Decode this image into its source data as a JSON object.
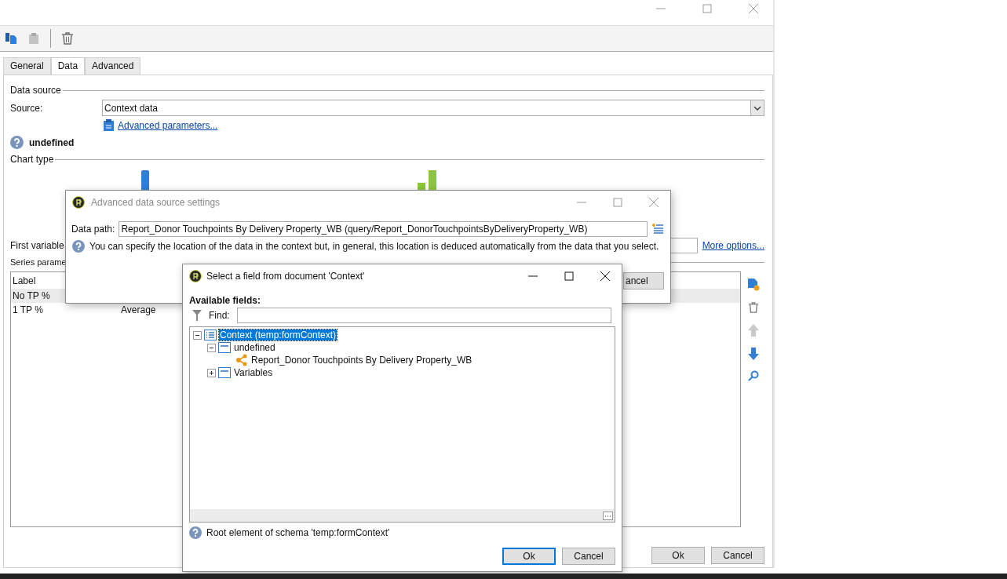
{
  "main_window": {
    "toolbar": [
      {
        "kind": "copy",
        "disabled": false
      },
      {
        "kind": "paste",
        "disabled": true
      },
      {
        "kind": "delete",
        "disabled": false
      }
    ],
    "tabs": [
      {
        "label": "General",
        "selected": false
      },
      {
        "label": "Data",
        "selected": true
      },
      {
        "label": "Advanced",
        "selected": false
      }
    ],
    "data_source": {
      "title": "Data source",
      "source_label": "Source:",
      "source_value": "Context data",
      "advanced_link": "Advanced parameters..."
    },
    "info_label": "undefined",
    "chart_type": {
      "title": "Chart type"
    },
    "first_variable_label": "First variable",
    "more_options_link": "More options...",
    "series": {
      "title": "Series parame",
      "columns": [
        "Label"
      ],
      "rows": [
        {
          "label": "No TP %",
          "selected": true
        },
        {
          "label": "1 TP %",
          "aggregate": "Average",
          "selected": false
        }
      ]
    },
    "buttons": [
      {
        "label": "Ok"
      },
      {
        "label": "Cancel"
      }
    ]
  },
  "advanced_dialog": {
    "title": "Advanced data source settings",
    "active": false,
    "data_path_label": "Data path:",
    "data_path_value": "Report_Donor Touchpoints By Delivery Property_WB (query/Report_DonorTouchpointsByDeliveryProperty_WB)",
    "hint": "You can specify the location of the data in the context but, in general, this location is deduced automatically from the data that you select.",
    "cancel": "ancel"
  },
  "field_dialog": {
    "title": "Select a field from document 'Context'",
    "active": true,
    "available_label": "Available fields:",
    "find_label": "Find:",
    "tree": [
      {
        "label": "Context (temp:formContext)",
        "kind": "list",
        "expanded": true,
        "selected": true,
        "children": [
          {
            "label": "undefined",
            "kind": "element",
            "expanded": true,
            "selected": false,
            "children": [
              {
                "label": "Report_Donor Touchpoints By Delivery Property_WB",
                "kind": "link",
                "selected": false
              }
            ]
          },
          {
            "label": "Variables",
            "kind": "element",
            "expanded": false,
            "selected": false
          }
        ]
      }
    ],
    "status": "Root element of schema 'temp:formContext'",
    "buttons": [
      {
        "label": "Ok",
        "default": true
      },
      {
        "label": "Cancel",
        "default": false
      }
    ]
  }
}
